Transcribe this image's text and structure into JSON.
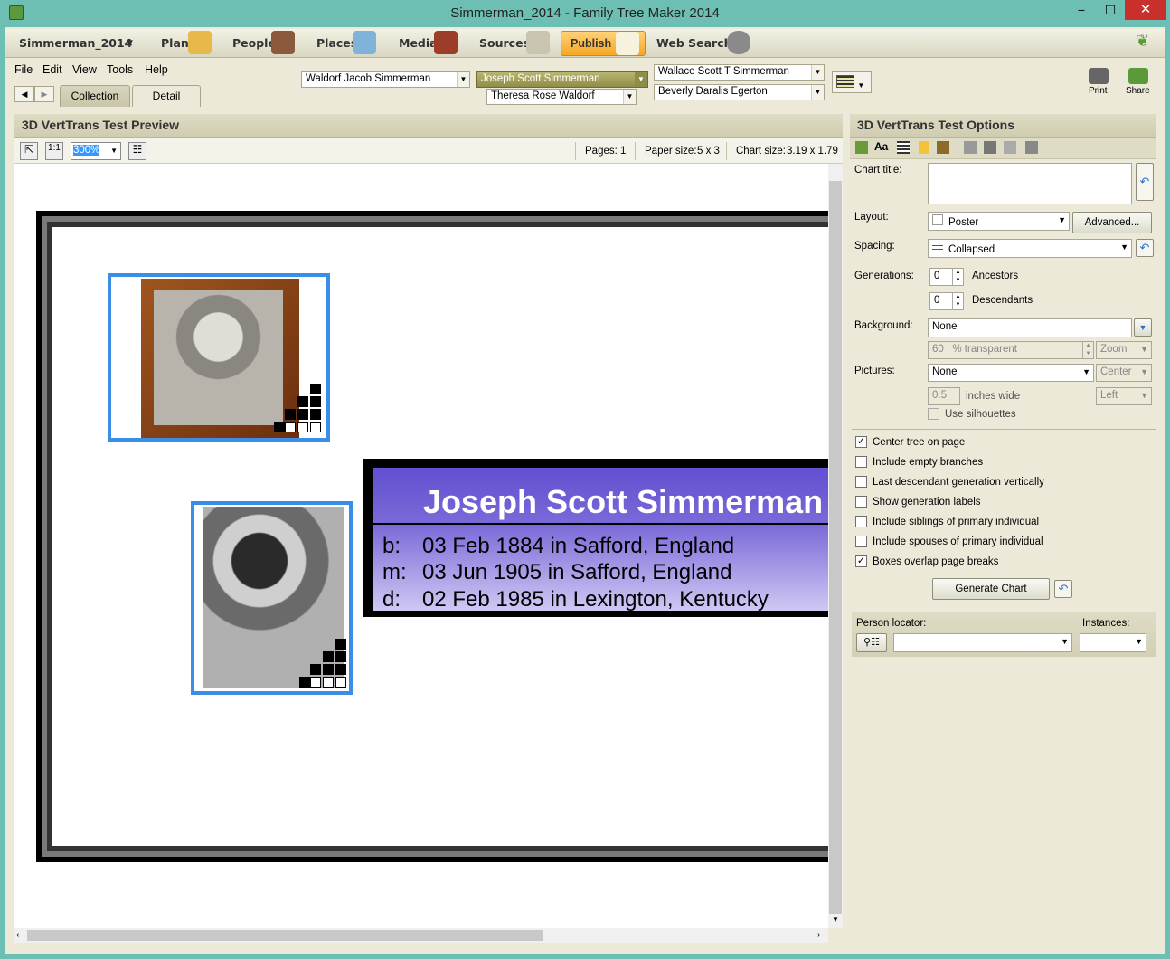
{
  "window": {
    "title": "Simmerman_2014 - Family Tree Maker 2014",
    "minimize": "−",
    "maximize": "☐",
    "close": "✕"
  },
  "toolbar": {
    "file_name": "Simmerman_2014",
    "plan": "Plan",
    "people": "People",
    "places": "Places",
    "media": "Media",
    "sources": "Sources",
    "publish": "Publish",
    "web_search": "Web Search"
  },
  "menu": {
    "file": "File",
    "edit": "Edit",
    "view": "View",
    "tools": "Tools",
    "help": "Help"
  },
  "nav": {
    "father": "Waldorf Jacob Simmerman",
    "current": "Joseph Scott Simmerman",
    "mother": "Theresa Rose Waldorf",
    "spouse_father": "Wallace Scott T Simmerman",
    "spouse_mother": "Beverly Daralis Egerton",
    "print": "Print",
    "share": "Share"
  },
  "tabs": {
    "collection": "Collection",
    "detail": "Detail"
  },
  "preview": {
    "title": "3D VertTrans Test Preview",
    "zoom": "300%",
    "pages_label": "Pages:",
    "pages": "1",
    "paper_label": "Paper size:",
    "paper": "5 x 3",
    "chart_label": "Chart size:",
    "chart": "3.19 x 1.79"
  },
  "person": {
    "name": "Joseph Scott Simmerman",
    "events": [
      {
        "k": "b:",
        "v": "03 Feb 1884 in Safford, England"
      },
      {
        "k": "m:",
        "v": "03 Jun 1905 in Safford, England"
      },
      {
        "k": "d:",
        "v": "02 Feb 1985 in Lexington, Kentucky"
      }
    ]
  },
  "options": {
    "title": "3D VertTrans Test Options",
    "chart_title_label": "Chart title:",
    "layout_label": "Layout:",
    "layout": "Poster",
    "advanced": "Advanced...",
    "spacing_label": "Spacing:",
    "spacing": "Collapsed",
    "generations_label": "Generations:",
    "ancestors": "0",
    "ancestors_label": "Ancestors",
    "descendants": "0",
    "descendants_label": "Descendants",
    "background_label": "Background:",
    "background": "None",
    "transparent_val": "60",
    "transparent_label": "% transparent",
    "bg_pos": "Zoom",
    "pictures_label": "Pictures:",
    "pictures": "None",
    "pic_pos": "Center",
    "width_val": "0.5",
    "width_label": "inches wide",
    "pic_align": "Left",
    "silhouettes": "Use silhouettes",
    "checks": [
      {
        "label": "Center tree on page",
        "checked": true
      },
      {
        "label": "Include empty branches",
        "checked": false
      },
      {
        "label": "Last descendant generation vertically",
        "checked": false
      },
      {
        "label": "Show generation labels",
        "checked": false
      },
      {
        "label": "Include siblings of primary individual",
        "checked": false
      },
      {
        "label": "Include spouses of primary individual",
        "checked": false
      },
      {
        "label": "Boxes overlap page breaks",
        "checked": true
      }
    ],
    "generate": "Generate Chart",
    "person_locator_label": "Person locator:",
    "instances_label": "Instances:"
  }
}
